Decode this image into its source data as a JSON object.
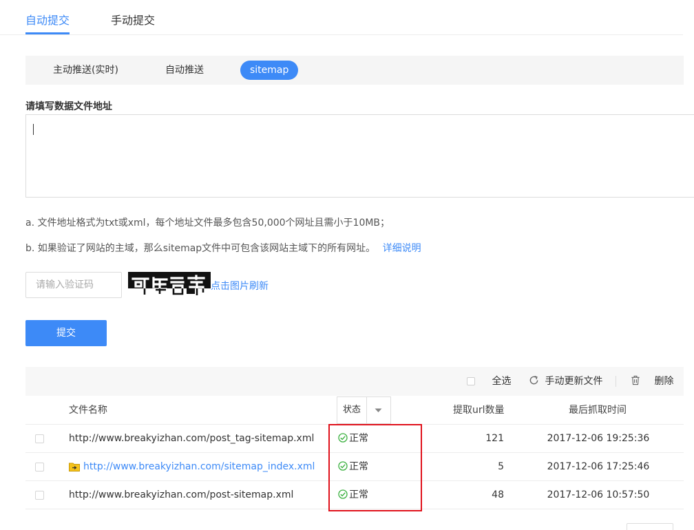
{
  "top_tabs": [
    {
      "label": "自动提交",
      "active": true
    },
    {
      "label": "手动提交",
      "active": false
    }
  ],
  "sub_tabs": [
    {
      "label": "主动推送(实时)",
      "active": false
    },
    {
      "label": "自动推送",
      "active": false
    },
    {
      "label": "sitemap",
      "active": true
    }
  ],
  "form": {
    "section_label": "请填写数据文件地址",
    "textarea_value": "",
    "hint_a": "a. 文件地址格式为txt或xml，每个地址文件最多包含50,000个网址且需小于10MB；",
    "hint_b": "b. 如果验证了网站的主域，那么sitemap文件中可包含该网站主域下的所有网址。",
    "hint_b_link": "详细说明",
    "captcha_placeholder": "请输入验证码",
    "captcha_refresh": "点击图片刷新",
    "submit_label": "提交"
  },
  "toolbar": {
    "select_all": "全选",
    "refresh": "手动更新文件",
    "delete": "删除"
  },
  "table": {
    "headers": {
      "file": "文件名称",
      "status": "状态",
      "count": "提取url数量",
      "time": "最后抓取时间"
    },
    "rows": [
      {
        "file": "http://www.breakyizhan.com/post_tag-sitemap.xml",
        "is_index": false,
        "status": "正常",
        "count": "121",
        "time": "2017-12-06 19:25:36"
      },
      {
        "file": "http://www.breakyizhan.com/sitemap_index.xml",
        "is_index": true,
        "status": "正常",
        "count": "5",
        "time": "2017-12-06 17:25:46"
      },
      {
        "file": "http://www.breakyizhan.com/post-sitemap.xml",
        "is_index": false,
        "status": "正常",
        "count": "48",
        "time": "2017-12-06 10:57:50"
      }
    ]
  },
  "colors": {
    "accent": "#3d8af7",
    "status_ok": "#3ab03e",
    "highlight": "#e0101a"
  }
}
